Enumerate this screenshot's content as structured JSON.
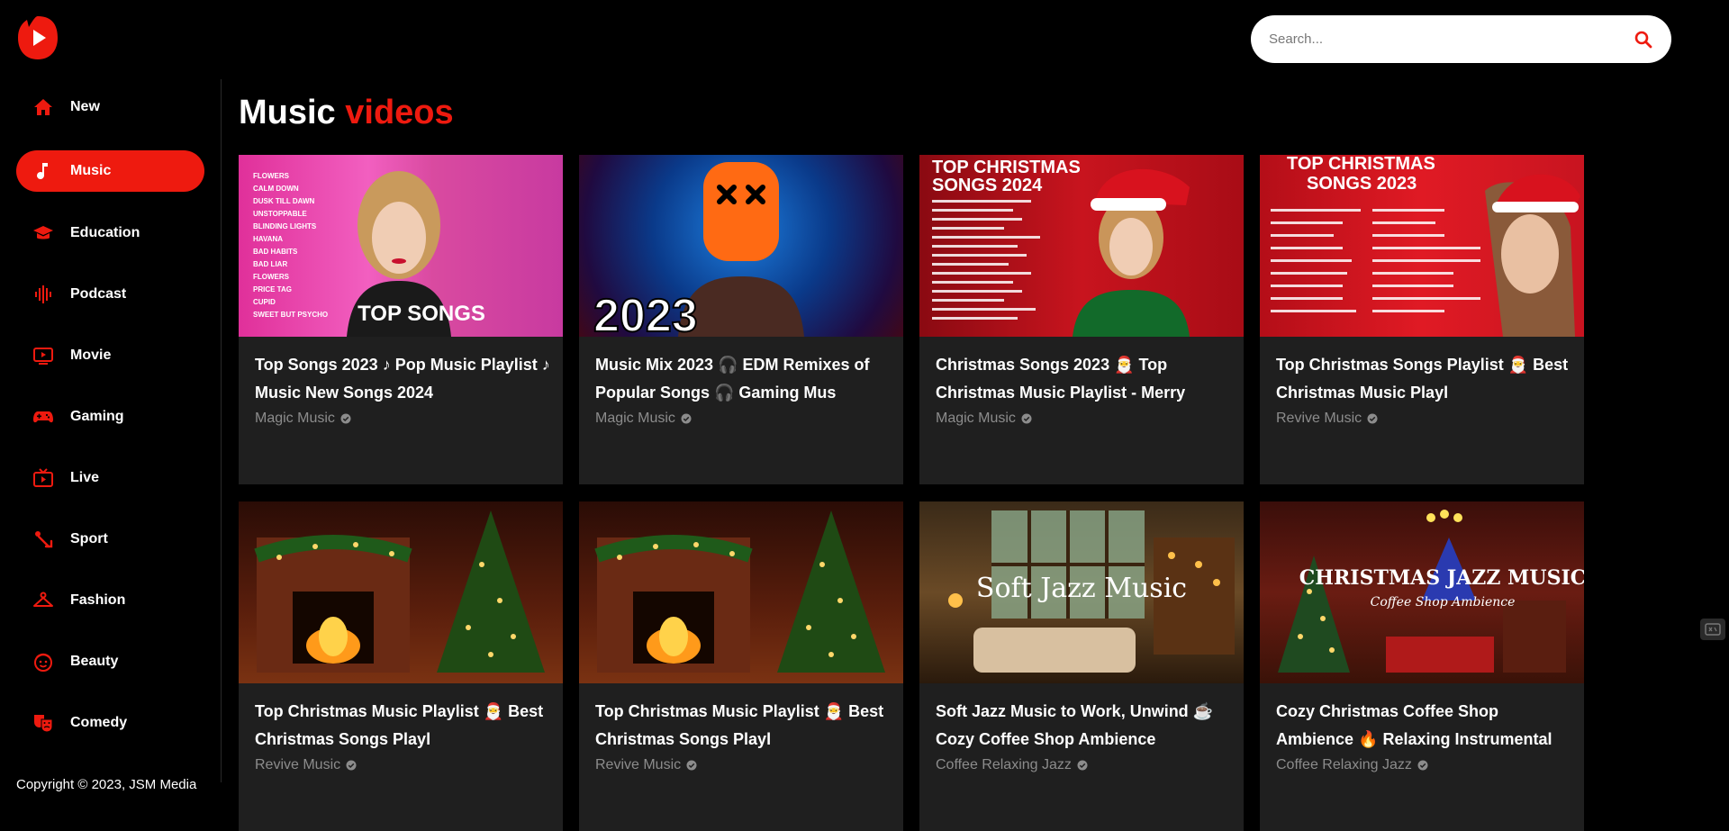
{
  "search": {
    "placeholder": "Search..."
  },
  "nav": [
    {
      "label": "New",
      "icon": "home-icon",
      "active": false
    },
    {
      "label": "Music",
      "icon": "music-note-icon",
      "active": true
    },
    {
      "label": "Education",
      "icon": "graduation-cap-icon",
      "active": false
    },
    {
      "label": "Podcast",
      "icon": "podcast-waveform-icon",
      "active": false
    },
    {
      "label": "Movie",
      "icon": "movie-play-icon",
      "active": false
    },
    {
      "label": "Gaming",
      "icon": "gamepad-icon",
      "active": false
    },
    {
      "label": "Live",
      "icon": "live-tv-icon",
      "active": false
    },
    {
      "label": "Sport",
      "icon": "sport-icon",
      "active": false
    },
    {
      "label": "Fashion",
      "icon": "hanger-icon",
      "active": false
    },
    {
      "label": "Beauty",
      "icon": "face-icon",
      "active": false
    },
    {
      "label": "Comedy",
      "icon": "comedy-masks-icon",
      "active": false
    }
  ],
  "copyright": "Copyright © 2023, JSM Media",
  "heading": {
    "main": "Music",
    "accent": "videos"
  },
  "videos": [
    {
      "title": "Top Songs 2023 ♪ Pop Music Playlist ♪ Music New Songs 2024",
      "channel": "Magic Music",
      "thumb": "top-songs",
      "thumb_text": "TOP SONGS"
    },
    {
      "title": "Music Mix 2023 🎧 EDM Remixes of Popular Songs 🎧 Gaming Mus",
      "channel": "Magic Music",
      "thumb": "edm",
      "thumb_text": "2023"
    },
    {
      "title": "Christmas Songs 2023 🎅 Top Christmas Music Playlist - Merry",
      "channel": "Magic Music",
      "thumb": "xmas2024",
      "thumb_text": "TOP CHRISTMAS SONGS 2024"
    },
    {
      "title": "Top Christmas Songs Playlist 🎅 Best Christmas Music Playl",
      "channel": "Revive Music",
      "thumb": "xmas2023",
      "thumb_text": "TOP CHRISTMAS SONGS 2023"
    },
    {
      "title": "Top Christmas Music Playlist 🎅 Best Christmas Songs Playl",
      "channel": "Revive Music",
      "thumb": "fireplace",
      "thumb_text": ""
    },
    {
      "title": "Top Christmas Music Playlist 🎅 Best Christmas Songs Playl",
      "channel": "Revive Music",
      "thumb": "fireplace",
      "thumb_text": ""
    },
    {
      "title": "Soft Jazz Music to Work, Unwind ☕ Cozy Coffee Shop Ambience",
      "channel": "Coffee Relaxing Jazz",
      "thumb": "jazz",
      "thumb_text": "Soft Jazz Music"
    },
    {
      "title": "Cozy Christmas Coffee Shop Ambience 🔥 Relaxing Instrumental",
      "channel": "Coffee Relaxing Jazz",
      "thumb": "xmasjazz",
      "thumb_text": "CHRISTMAS JAZZ MUSIC",
      "thumb_subtext": "Coffee Shop Ambience"
    }
  ],
  "colors": {
    "accent": "#ee1a0f",
    "card_bg": "#1f1f1f",
    "channel_text": "#8c8c8c"
  }
}
